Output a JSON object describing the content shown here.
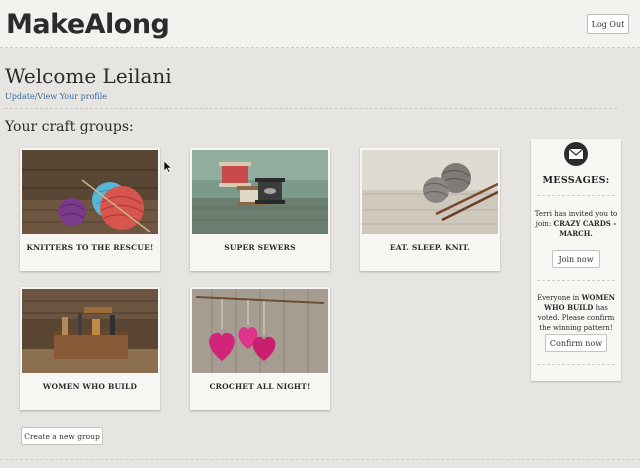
{
  "header": {
    "logo": "MakeAlong",
    "logout_label": "Log Out"
  },
  "welcome": {
    "title": "Welcome Leilani",
    "profile_link": "Update/View Your profile"
  },
  "groups": {
    "heading": "Your craft groups:",
    "items": [
      {
        "title": "KNITTERS TO THE RESCUE!",
        "image": "yarn-balls-photo"
      },
      {
        "title": "SUPER SEWERS",
        "image": "thread-spools-photo"
      },
      {
        "title": "EAT. SLEEP. KNIT.",
        "image": "yarn-needles-photo"
      },
      {
        "title": "WOMEN WHO BUILD",
        "image": "toolbox-photo"
      },
      {
        "title": "CROCHET ALL NIGHT!",
        "image": "crochet-hearts-photo"
      }
    ],
    "create_label": "Create a new group"
  },
  "messages": {
    "icon": "mail-icon",
    "heading": "MESSAGES:",
    "items": [
      {
        "text_before": "Terri has invited you to join:",
        "highlight": "CRAZY CARDS - MARCH.",
        "text_after": "",
        "button": "Join now"
      },
      {
        "text_before": "Everyone in",
        "highlight": "WOMEN WHO BUILD",
        "text_after": "has voted. Please confirm the winning pattern!",
        "button": "Confirm now"
      }
    ]
  },
  "colors": {
    "background": "#e6e5e1",
    "card": "#f7f6f3",
    "link": "#3b6aa0"
  }
}
